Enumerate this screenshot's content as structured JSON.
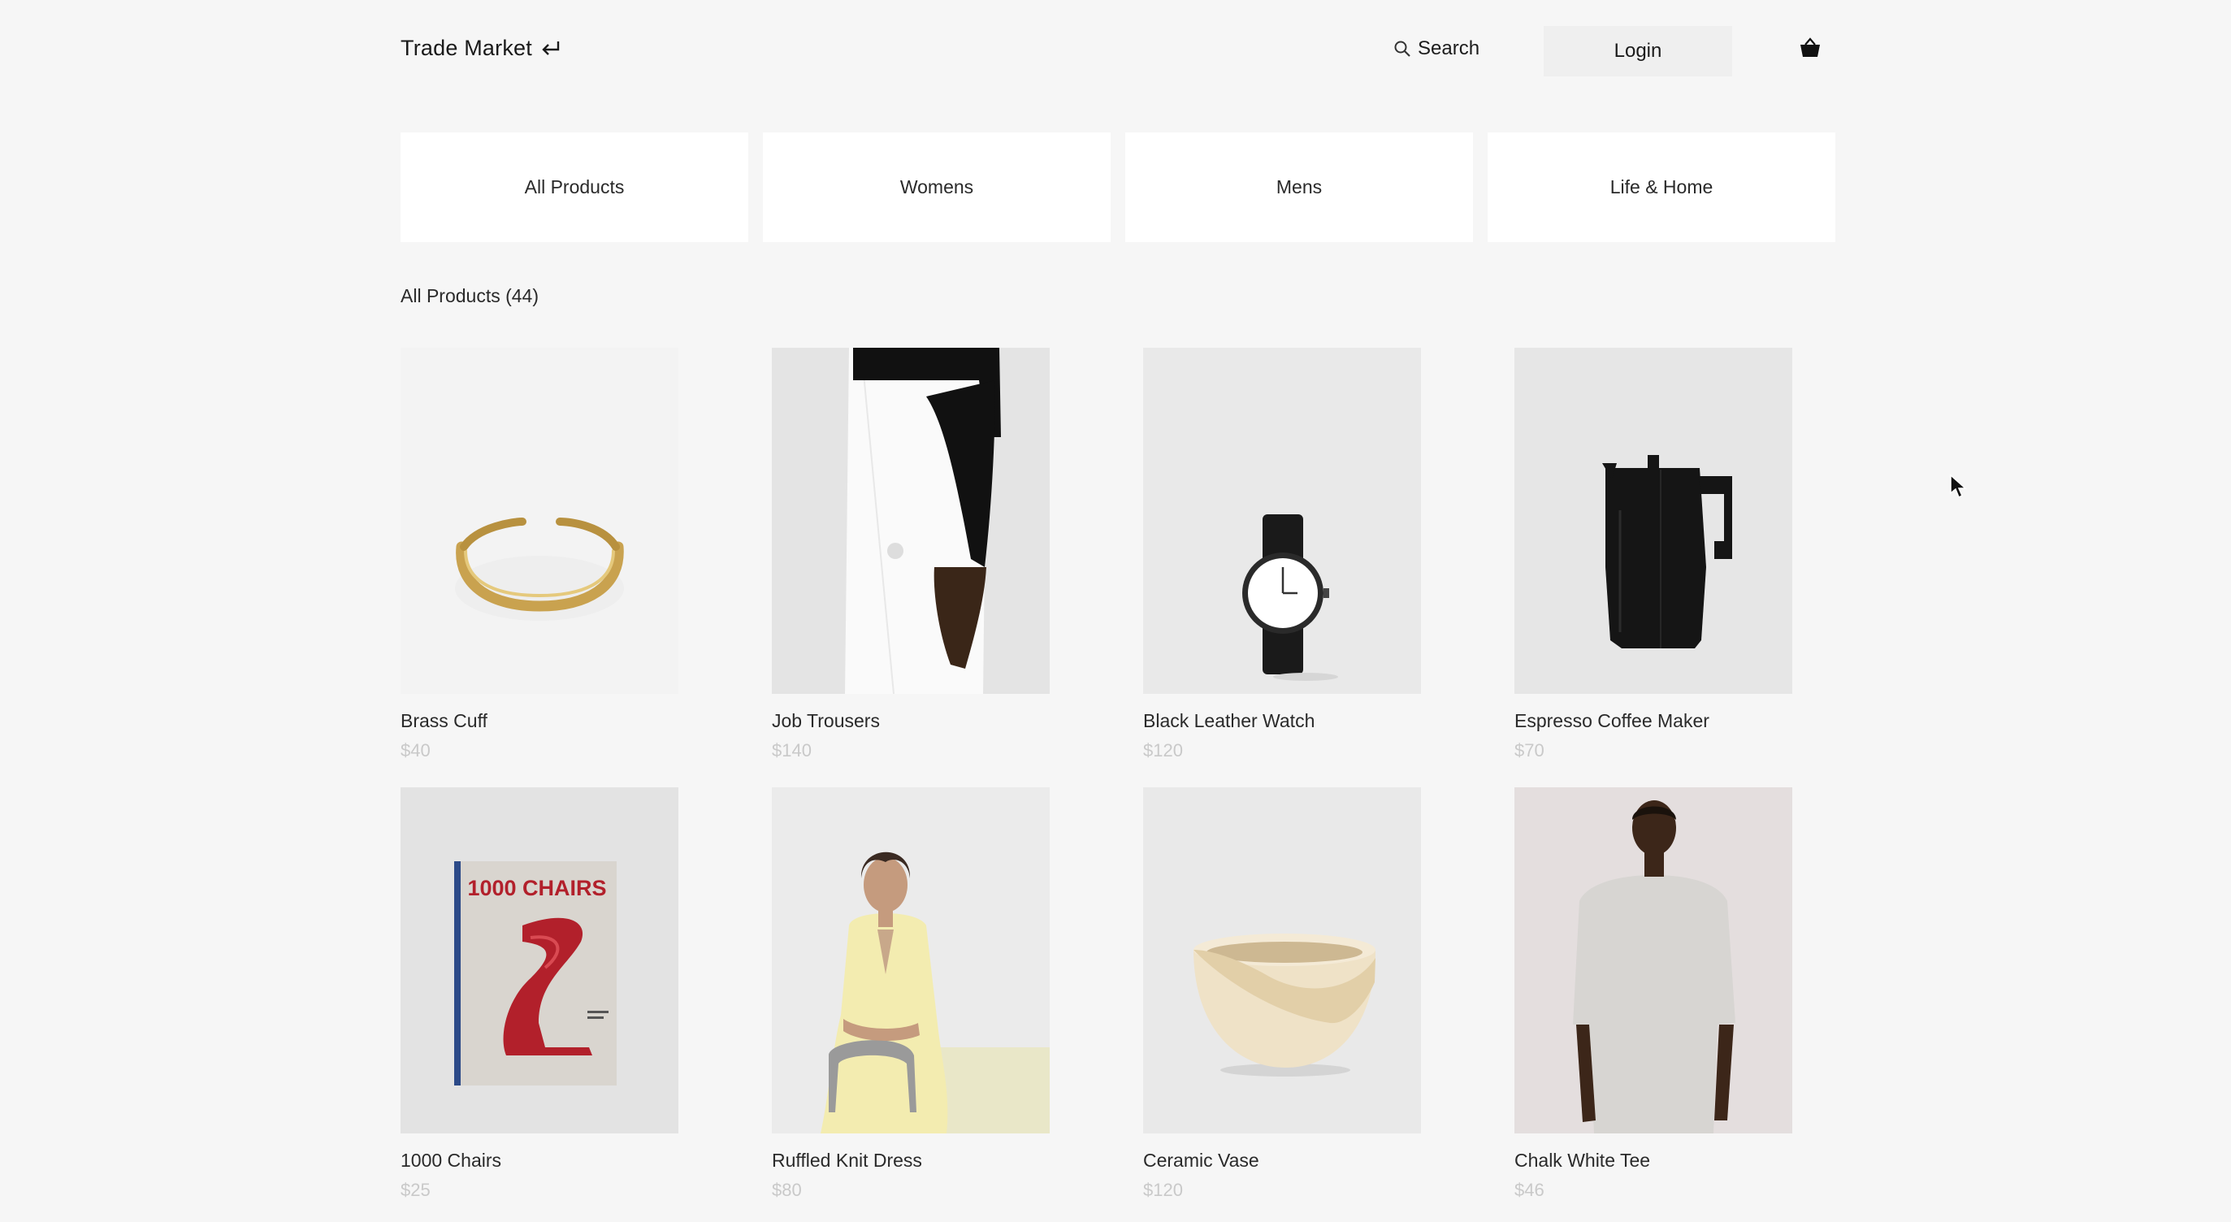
{
  "header": {
    "brand": "Trade Market",
    "search_label": "Search",
    "login_label": "Login"
  },
  "categories": [
    "All Products",
    "Womens",
    "Mens",
    "Life & Home"
  ],
  "section_title": "All Products (44)",
  "products": [
    {
      "name": "Brass Cuff",
      "price": "$40",
      "icon": "brass-cuff-image"
    },
    {
      "name": "Job Trousers",
      "price": "$140",
      "icon": "trousers-image"
    },
    {
      "name": "Black Leather Watch",
      "price": "$120",
      "icon": "watch-image"
    },
    {
      "name": "Espresso Coffee Maker",
      "price": "$70",
      "icon": "coffee-maker-image"
    },
    {
      "name": "1000 Chairs",
      "price": "$25",
      "icon": "book-image",
      "cover_text": "1000 CHAIRS"
    },
    {
      "name": "Ruffled Knit Dress",
      "price": "$80",
      "icon": "dress-image"
    },
    {
      "name": "Ceramic Vase",
      "price": "$120",
      "icon": "vase-image"
    },
    {
      "name": "Chalk White Tee",
      "price": "$46",
      "icon": "tee-image"
    }
  ],
  "colors": {
    "background": "#f6f6f6",
    "price_text": "#c9c9c9",
    "brass": "#c9a24f",
    "book_red": "#b2202b"
  }
}
